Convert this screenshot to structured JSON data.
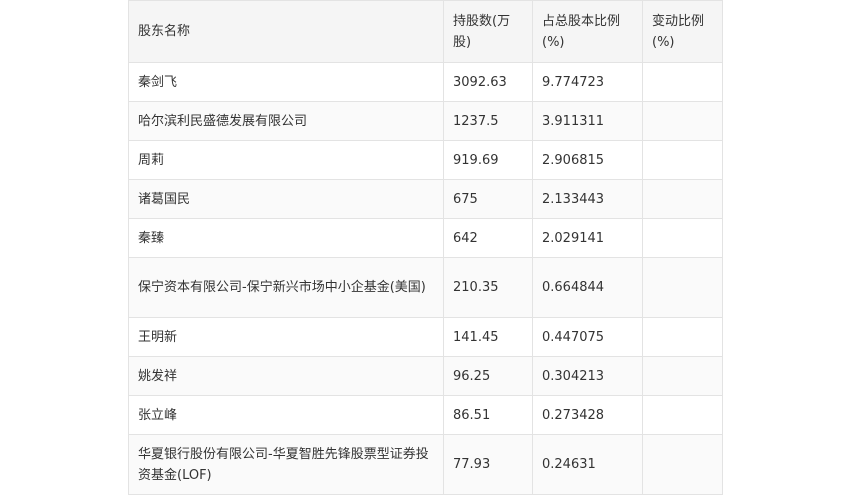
{
  "table": {
    "headers": [
      "股东名称",
      "持股数(万股)",
      "占总股本比例(%)",
      "变动比例(%)"
    ],
    "rows": [
      {
        "name": "秦剑飞",
        "shares": "3092.63",
        "ratio": "9.774723",
        "change": ""
      },
      {
        "name": "哈尔滨利民盛德发展有限公司",
        "shares": "1237.5",
        "ratio": "3.911311",
        "change": ""
      },
      {
        "name": "周莉",
        "shares": "919.69",
        "ratio": "2.906815",
        "change": ""
      },
      {
        "name": "诸葛国民",
        "shares": "675",
        "ratio": "2.133443",
        "change": ""
      },
      {
        "name": "秦臻",
        "shares": "642",
        "ratio": "2.029141",
        "change": ""
      },
      {
        "name": "保宁资本有限公司-保宁新兴市场中小企基金(美国)",
        "shares": "210.35",
        "ratio": "0.664844",
        "change": ""
      },
      {
        "name": "王明新",
        "shares": "141.45",
        "ratio": "0.447075",
        "change": ""
      },
      {
        "name": "姚发祥",
        "shares": "96.25",
        "ratio": "0.304213",
        "change": ""
      },
      {
        "name": "张立峰",
        "shares": "86.51",
        "ratio": "0.273428",
        "change": ""
      },
      {
        "name": "华夏银行股份有限公司-华夏智胜先锋股票型证券投资基金(LOF)",
        "shares": "77.93",
        "ratio": "0.24631",
        "change": ""
      }
    ]
  }
}
